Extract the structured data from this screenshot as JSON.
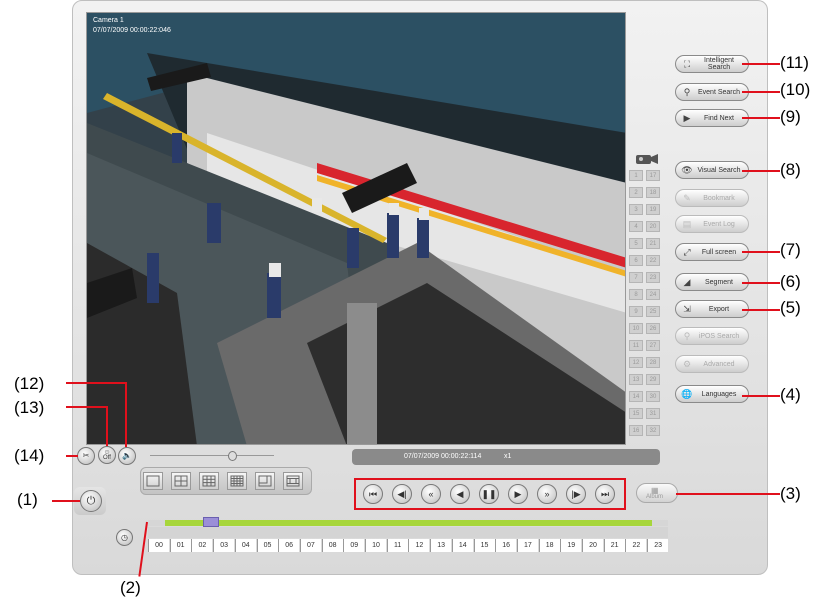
{
  "video": {
    "camera_label": "Camera 1",
    "timestamp": "07/07/2009 00:00:22:046"
  },
  "status_bar": {
    "time": "07/07/2009 00:00:22:114",
    "speed": "x1"
  },
  "channels": [
    "1",
    "2",
    "3",
    "4",
    "5",
    "6",
    "7",
    "8",
    "9",
    "10",
    "11",
    "12",
    "13",
    "14",
    "15",
    "16",
    "17",
    "18",
    "19",
    "20",
    "21",
    "22",
    "23",
    "24",
    "25",
    "26",
    "27",
    "28",
    "29",
    "30",
    "31",
    "32"
  ],
  "right_buttons": [
    {
      "label": "Intelligent Search",
      "icon": "intelligent-search-icon",
      "enabled": true
    },
    {
      "label": "Event Search",
      "icon": "event-search-icon",
      "enabled": true
    },
    {
      "label": "Find Next",
      "icon": "find-next-icon",
      "enabled": true
    },
    {
      "label": "Visual Search",
      "icon": "visual-search-icon",
      "enabled": true
    },
    {
      "label": "Bookmark",
      "icon": "bookmark-icon",
      "enabled": false
    },
    {
      "label": "Event Log",
      "icon": "event-log-icon",
      "enabled": false
    },
    {
      "label": "Full screen",
      "icon": "full-screen-icon",
      "enabled": true
    },
    {
      "label": "Segment",
      "icon": "segment-icon",
      "enabled": true
    },
    {
      "label": "Export",
      "icon": "export-icon",
      "enabled": true
    },
    {
      "label": "iPOS Search",
      "icon": "ipos-search-icon",
      "enabled": false
    },
    {
      "label": "Advanced",
      "icon": "advanced-icon",
      "enabled": false
    },
    {
      "label": "Languages",
      "icon": "languages-icon",
      "enabled": true
    }
  ],
  "callouts": [
    "(1)",
    "(2)",
    "(3)",
    "(4)",
    "(5)",
    "(6)",
    "(7)",
    "(8)",
    "(9)",
    "(10)",
    "(11)",
    "(12)",
    "(13)",
    "(14)"
  ],
  "playback": [
    "first-frame",
    "previous-frame",
    "fast-rewind",
    "play-reverse",
    "pause",
    "play",
    "fast-forward",
    "next-frame",
    "last-frame"
  ],
  "album_label": "Album",
  "off_label": "Off",
  "hours": [
    "00",
    "01",
    "02",
    "03",
    "04",
    "05",
    "06",
    "07",
    "08",
    "09",
    "10",
    "11",
    "12",
    "13",
    "14",
    "15",
    "16",
    "17",
    "18",
    "19",
    "20",
    "21",
    "22",
    "23"
  ],
  "colors": {
    "callout_line": "#e0101c",
    "timeline_fill": "#a7d63b",
    "timeline_marker": "#9b8fd8"
  }
}
